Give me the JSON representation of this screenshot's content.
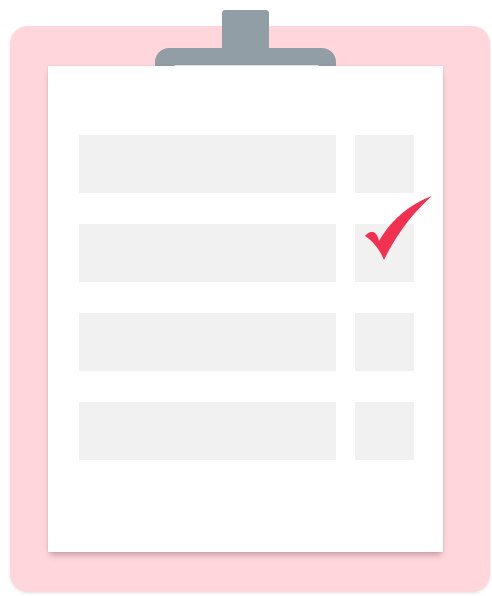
{
  "colors": {
    "board": "#ffd6dc",
    "clip": "#929ea6",
    "paper": "#ffffff",
    "placeholder": "#f1f1f1",
    "check": "#f2304f"
  },
  "clipboard": {
    "icon": "clipboard-checklist-icon",
    "items": [
      {
        "checked": false
      },
      {
        "checked": true
      },
      {
        "checked": false
      },
      {
        "checked": false
      }
    ]
  }
}
